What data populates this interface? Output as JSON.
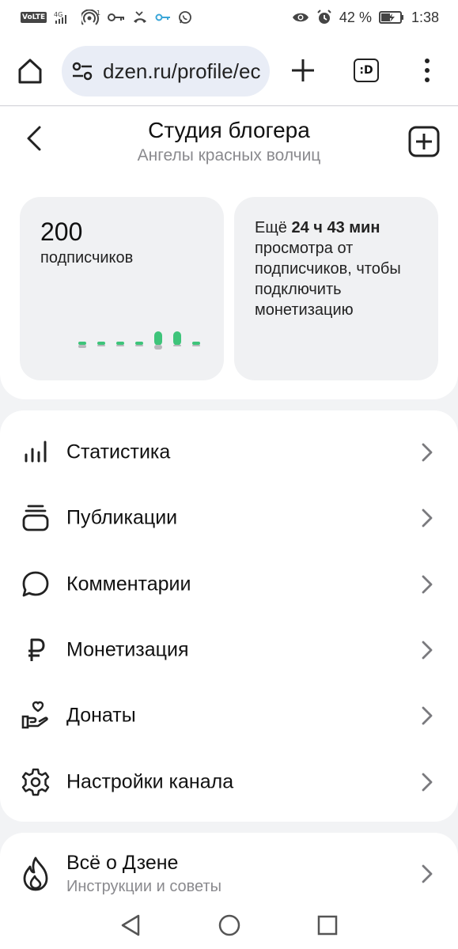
{
  "status_bar": {
    "volte": "VoLTE",
    "network": "4G",
    "signal_super": "1",
    "battery": "42 %",
    "time": "1:38"
  },
  "browser": {
    "url": "dzen.ru/profile/ec",
    "tab_label": ":D"
  },
  "header": {
    "title": "Студия блогера",
    "subtitle": "Ангелы красных волчиц"
  },
  "subscribers": {
    "count": "200",
    "label": "подписчиков"
  },
  "monetization_card": {
    "prefix": "Ещё ",
    "time": "24 ч 43 мин",
    "rest": "просмотра от подписчиков, чтобы подключить монетизацию"
  },
  "menu": {
    "items": [
      {
        "label": "Статистика",
        "icon": "stats-icon"
      },
      {
        "label": "Публикации",
        "icon": "publications-icon"
      },
      {
        "label": "Комментарии",
        "icon": "comments-icon"
      },
      {
        "label": "Монетизация",
        "icon": "ruble-icon"
      },
      {
        "label": "Донаты",
        "icon": "donate-icon"
      },
      {
        "label": "Настройки канала",
        "icon": "gear-icon"
      }
    ]
  },
  "about": {
    "title": "Всё о Дзене",
    "subtitle": "Инструкции и советы",
    "icon": "flame-icon"
  },
  "colors": {
    "accent_green": "#3ec47a",
    "secondary_text": "#8a8a8e",
    "card_bg": "#f0f1f3"
  }
}
